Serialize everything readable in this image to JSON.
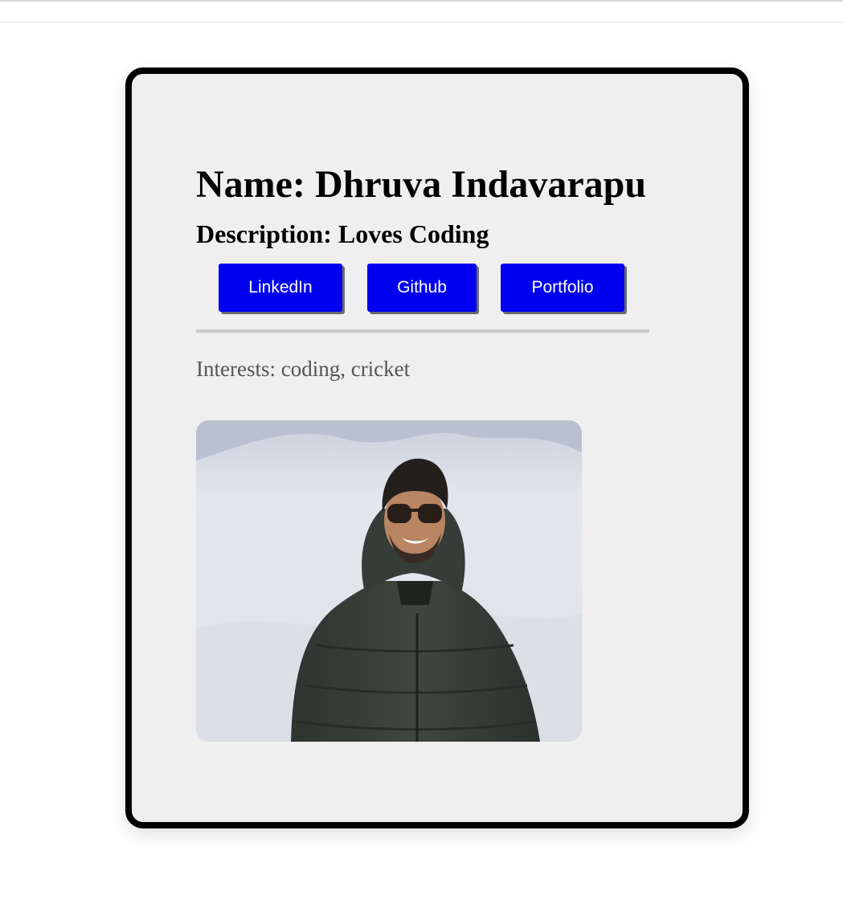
{
  "profile": {
    "name": "Name: Dhruva Indavarapu",
    "description": "Description: Loves Coding",
    "interests": "Interests: coding, cricket"
  },
  "links": {
    "linkedin_label": "LinkedIn",
    "github_label": "Github",
    "portfolio_label": "Portfolio"
  },
  "photo": {
    "alt": "Photo of a smiling man in sunglasses and a dark green puffer jacket standing on snow"
  },
  "colors": {
    "button_bg": "#0000ee",
    "button_text": "#ffffff",
    "card_bg": "#efefef",
    "card_border": "#000000",
    "interests_text": "#555555"
  }
}
